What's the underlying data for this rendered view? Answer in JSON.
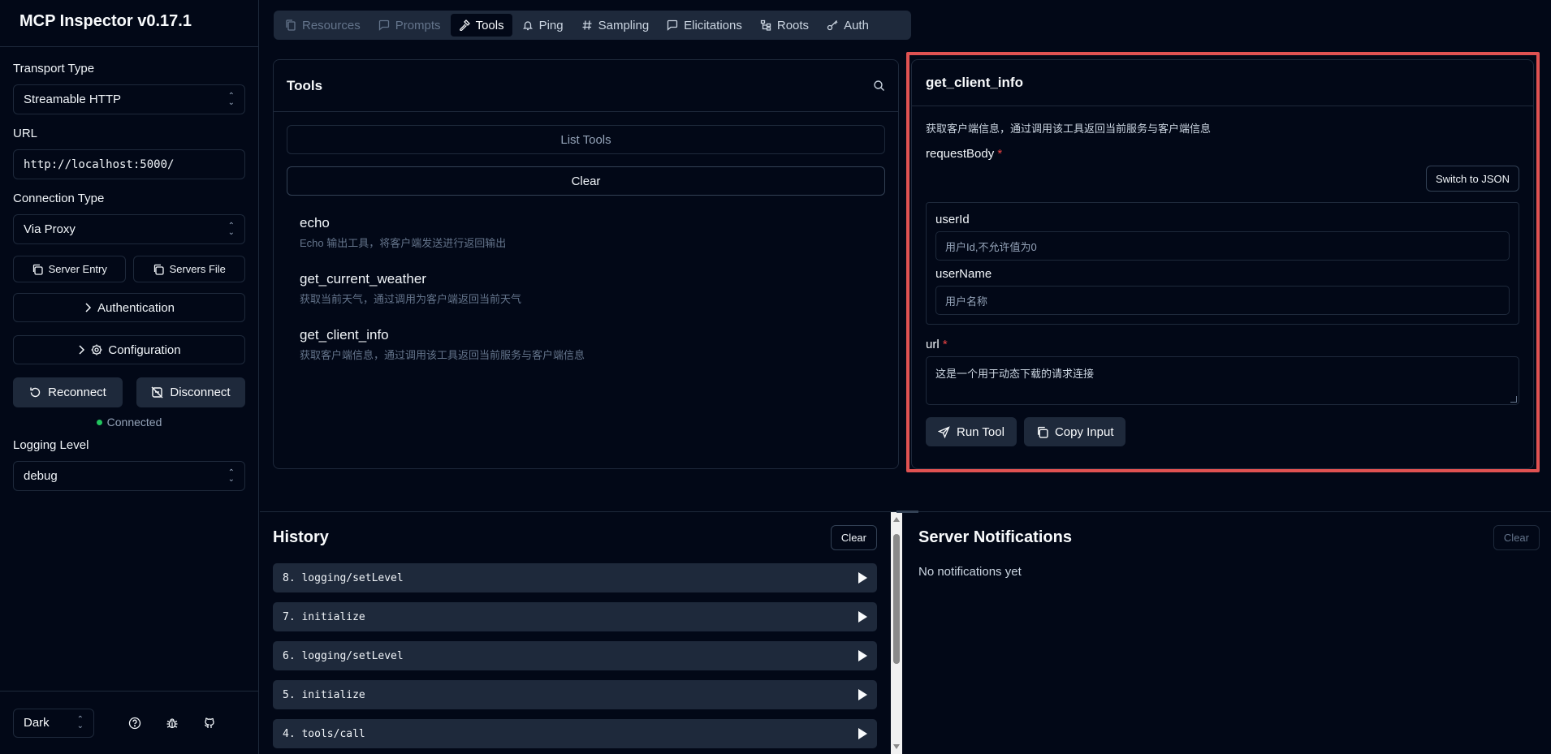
{
  "app": {
    "title": "MCP Inspector v0.17.1"
  },
  "sidebar": {
    "transport_label": "Transport Type",
    "transport_value": "Streamable HTTP",
    "url_label": "URL",
    "url_value": "http://localhost:5000/",
    "connection_label": "Connection Type",
    "connection_value": "Via Proxy",
    "server_entry": "Server Entry",
    "servers_file": "Servers File",
    "authentication": "Authentication",
    "configuration": "Configuration",
    "reconnect": "Reconnect",
    "disconnect": "Disconnect",
    "status": "Connected",
    "logging_label": "Logging Level",
    "logging_value": "debug",
    "theme_value": "Dark"
  },
  "tabs": [
    {
      "label": "Resources",
      "icon": "files-icon",
      "state": "disabled"
    },
    {
      "label": "Prompts",
      "icon": "message-icon",
      "state": "disabled"
    },
    {
      "label": "Tools",
      "icon": "hammer-icon",
      "state": "active"
    },
    {
      "label": "Ping",
      "icon": "bell-icon",
      "state": "normal"
    },
    {
      "label": "Sampling",
      "icon": "hash-icon",
      "state": "normal"
    },
    {
      "label": "Elicitations",
      "icon": "message-icon",
      "state": "normal"
    },
    {
      "label": "Roots",
      "icon": "folder-tree-icon",
      "state": "normal"
    },
    {
      "label": "Auth",
      "icon": "key-icon",
      "state": "normal"
    }
  ],
  "tools": {
    "title": "Tools",
    "list_button": "List Tools",
    "clear_button": "Clear",
    "items": [
      {
        "name": "echo",
        "desc": "Echo 输出工具，将客户端发送进行返回输出"
      },
      {
        "name": "get_current_weather",
        "desc": "获取当前天气，通过调用为客户端返回当前天气"
      },
      {
        "name": "get_client_info",
        "desc": "获取客户端信息，通过调用该工具返回当前服务与客户端信息"
      }
    ]
  },
  "detail": {
    "title": "get_client_info",
    "desc": "获取客户端信息，通过调用该工具返回当前服务与客户端信息",
    "request_body_label": "requestBody",
    "required_mark": "*",
    "switch_json": "Switch to JSON",
    "userid_label": "userId",
    "userid_placeholder": "用户Id,不允许值为0",
    "username_label": "userName",
    "username_placeholder": "用户名称",
    "url_label": "url",
    "url_placeholder": "这是一个用于动态下载的请求连接",
    "run_tool": "Run Tool",
    "copy_input": "Copy Input"
  },
  "history": {
    "title": "History",
    "clear": "Clear",
    "items": [
      "8. logging/setLevel",
      "7. initialize",
      "6. logging/setLevel",
      "5. initialize",
      "4. tools/call"
    ]
  },
  "notifications": {
    "title": "Server Notifications",
    "clear": "Clear",
    "empty": "No notifications yet"
  },
  "colors": {
    "background": "#020817",
    "border": "#1e293b",
    "accent_outline": "#e05252",
    "connected": "#22c55e",
    "required": "#ef4444"
  }
}
